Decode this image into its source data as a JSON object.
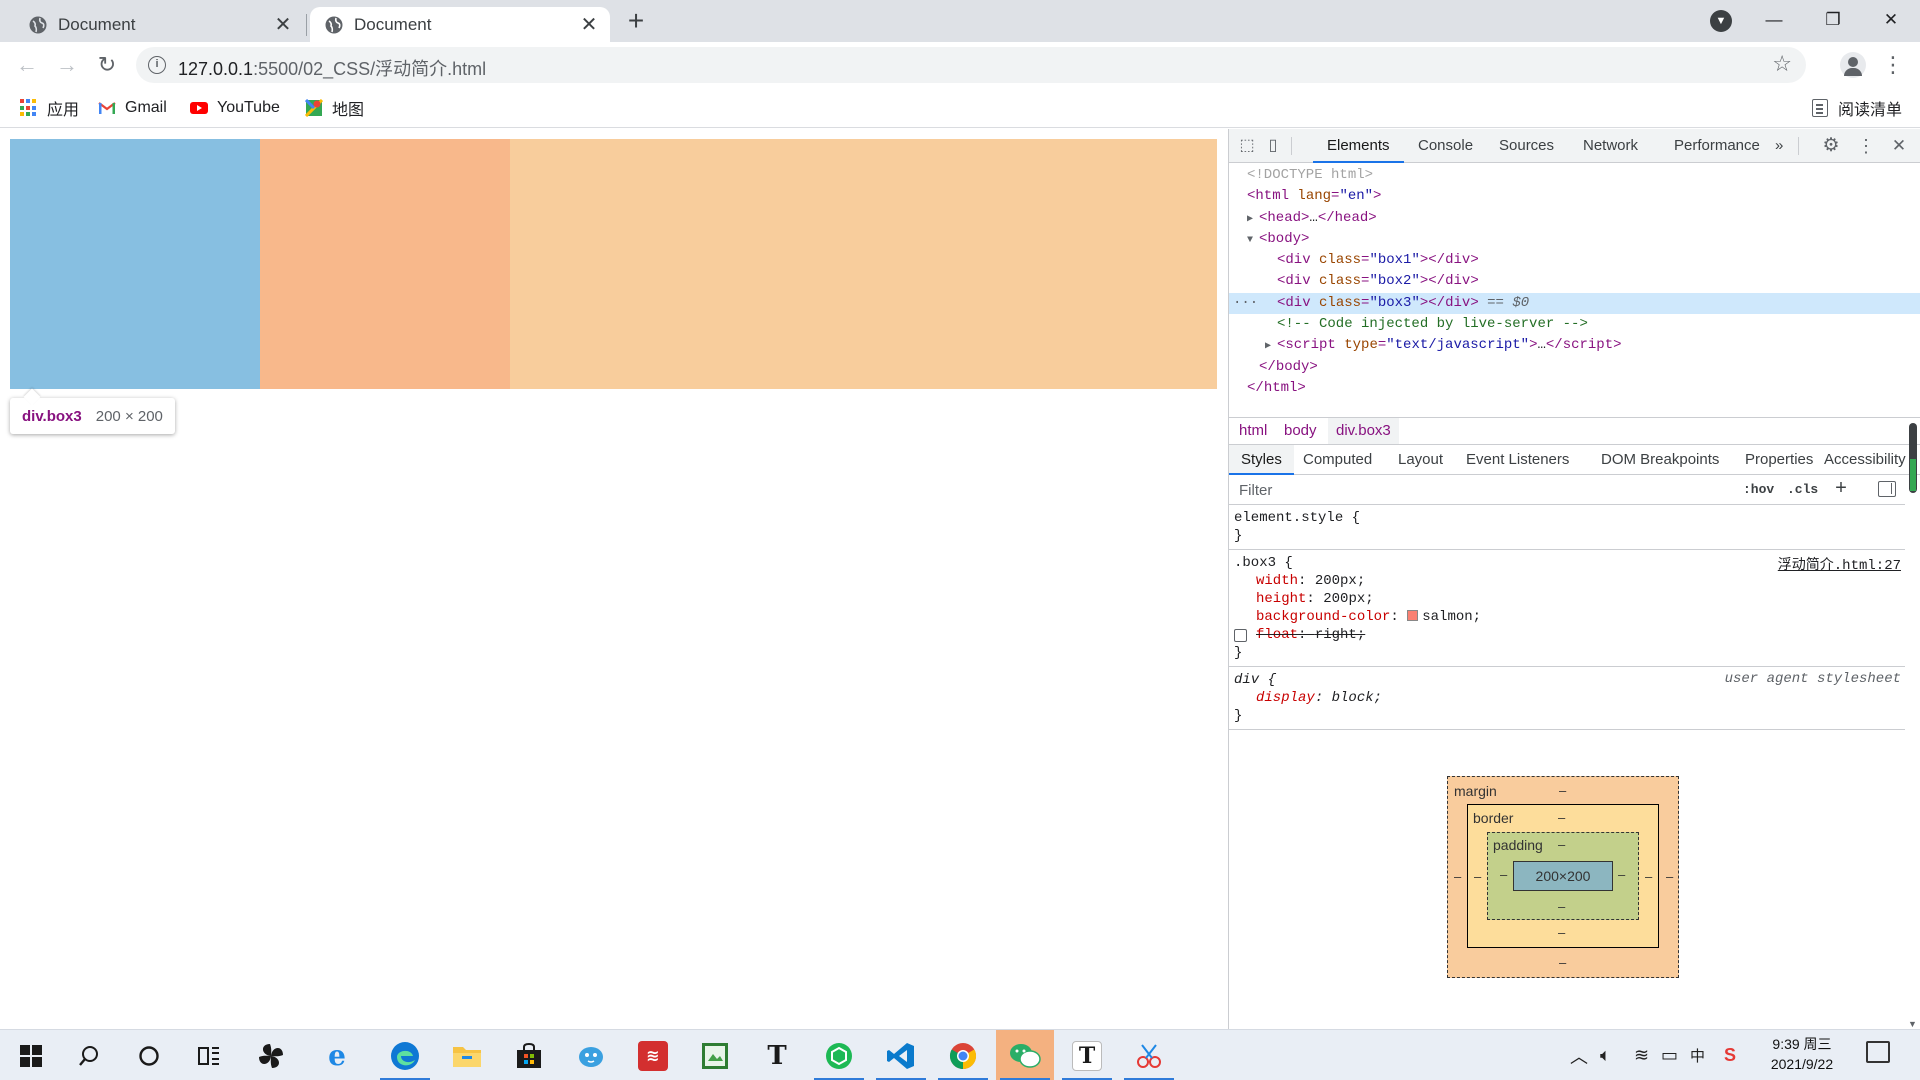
{
  "browser": {
    "tabs": [
      {
        "title": "Document",
        "active": false
      },
      {
        "title": "Document",
        "active": true
      }
    ],
    "url": {
      "host": "127.0.0.1",
      "rest": ":5500/02_CSS/浮动简介.html"
    },
    "bookmarks": [
      {
        "label": "应用",
        "icon": "apps-grid-icon"
      },
      {
        "label": "Gmail",
        "icon": "gmail-icon"
      },
      {
        "label": "YouTube",
        "icon": "youtube-icon"
      },
      {
        "label": "地图",
        "icon": "maps-icon"
      }
    ],
    "reading_list": "阅读清单"
  },
  "page": {
    "box_colors": [
      "#87bfe1",
      "#f8b88b",
      "#f8cd9c"
    ],
    "tooltip": {
      "name": "div.box3",
      "size": "200 × 200"
    }
  },
  "devtools": {
    "tabs": [
      "Elements",
      "Console",
      "Sources",
      "Network",
      "Performance"
    ],
    "active_tab": "Elements",
    "more": "»",
    "dom": {
      "doctype": "<!DOCTYPE html>",
      "html_open_tag": "html",
      "html_lang_attr": "lang",
      "html_lang_val": "\"en\"",
      "head": "head",
      "head_collapsed": "…",
      "body": "body",
      "div_tag": "div",
      "class_attr": "class",
      "box1": "\"box1\"",
      "box2": "\"box2\"",
      "box3": "\"box3\"",
      "selected_suffix": "== $0",
      "comment": "<!-- Code injected by live-server -->",
      "script_tag": "script",
      "type_attr": "type",
      "type_val": "\"text/javascript\"",
      "ellipsis": "…"
    },
    "breadcrumbs": [
      "html",
      "body",
      "div.box3"
    ],
    "styles_tabs": [
      "Styles",
      "Computed",
      "Layout",
      "Event Listeners",
      "DOM Breakpoints",
      "Properties",
      "Accessibility"
    ],
    "filter_placeholder": "Filter",
    "filter_tools": {
      "hov": ":hov",
      "cls": ".cls",
      "add": "+"
    },
    "rules": {
      "element_style": "element.style {",
      "close": "}",
      "box3_selector": ".box3 {",
      "box3_source": "浮动简介.html:27",
      "box3_props": [
        {
          "name": "width",
          "value": "200px;"
        },
        {
          "name": "height",
          "value": "200px;"
        },
        {
          "name": "background-color",
          "value": "salmon;",
          "swatch": "#fa8072"
        },
        {
          "name": "float",
          "value": "right;",
          "disabled": true
        }
      ],
      "div_selector": "div {",
      "div_source": "user agent stylesheet",
      "div_props": [
        {
          "name": "display",
          "value": "block;"
        }
      ]
    },
    "box_model": {
      "margin": "margin",
      "border": "border",
      "padding": "padding",
      "content": "200×200",
      "dash": "–"
    }
  },
  "taskbar": {
    "time": "9:39 周三",
    "date": "2021/9/22",
    "apps": [
      "windows-start-icon",
      "search-icon",
      "cortana-icon",
      "task-view-icon",
      "app-pinwheel-icon",
      "ie-icon",
      "edge-icon",
      "file-explorer-icon",
      "store-icon",
      "bird-app-icon",
      "red-app-icon",
      "photo-app-icon",
      "typora-icon",
      "green-app-icon",
      "vscode-icon",
      "chrome-icon",
      "wechat-icon",
      "text-app-icon",
      "snip-app-icon"
    ]
  }
}
